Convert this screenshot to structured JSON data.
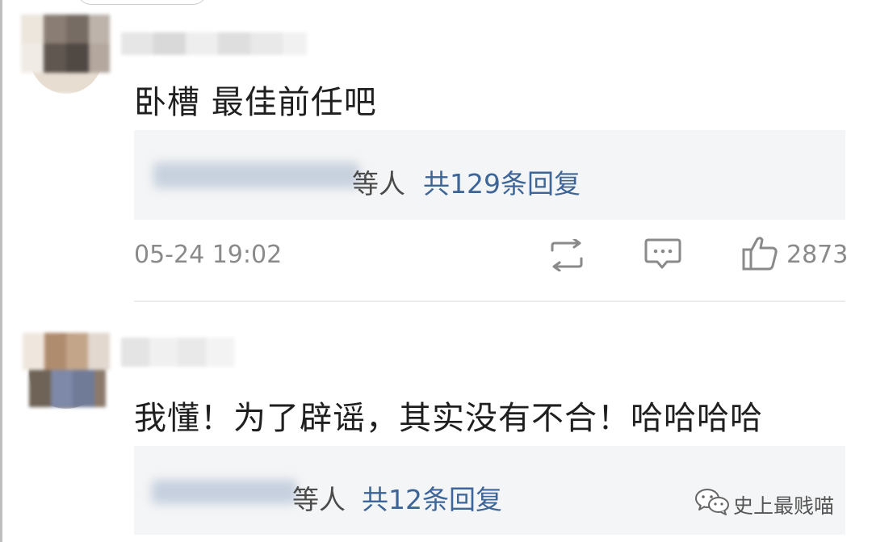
{
  "comments": [
    {
      "text": "卧槽 最佳前任吧",
      "reply_suffix": "等人",
      "reply_count_text": "共129条回复",
      "timestamp": "05-24 19:02",
      "like_count": "2873",
      "icons": [
        "repost-icon",
        "comment-icon",
        "like-icon"
      ]
    },
    {
      "text": "我懂！为了辟谣，其实没有不合！哈哈哈哈",
      "reply_suffix": "等人",
      "reply_count_text": "共12条回复"
    }
  ],
  "watermark": {
    "text": "史上最贱喵",
    "icon": "wechat-icon"
  },
  "colors": {
    "reply_link": "#3d6597",
    "meta_text": "#8a8a8a",
    "reply_box_bg": "#f4f5f6"
  }
}
